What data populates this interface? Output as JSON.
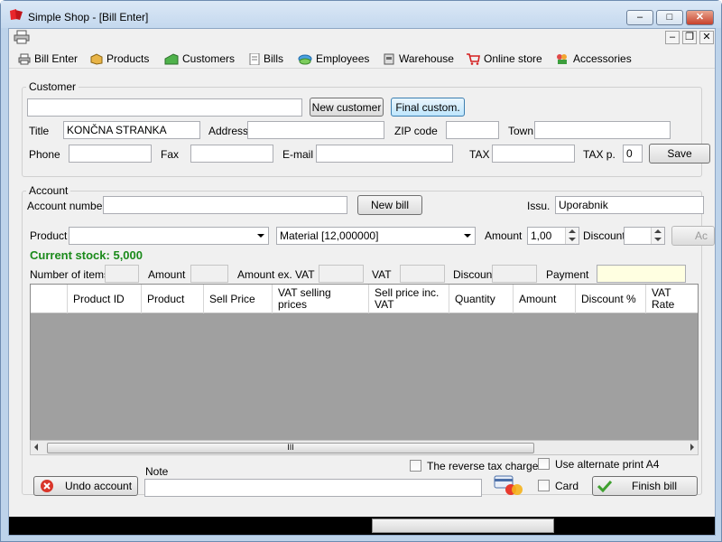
{
  "window": {
    "title": "Simple Shop - [Bill Enter]"
  },
  "titlebar_buttons": {
    "minimize": "‒",
    "maximize": "□",
    "close": "✕"
  },
  "mdi_buttons": {
    "minimize": "–",
    "restore": "❐",
    "close": "✕"
  },
  "menu": [
    {
      "label": "Bill Enter",
      "icon": "printer-icon"
    },
    {
      "label": "Products",
      "icon": "box-icon"
    },
    {
      "label": "Customers",
      "icon": "flag-icon"
    },
    {
      "label": "Bills",
      "icon": "document-icon"
    },
    {
      "label": "Employees",
      "icon": "people-icon"
    },
    {
      "label": "Warehouse",
      "icon": "warehouse-icon"
    },
    {
      "label": "Online store",
      "icon": "cart-icon"
    },
    {
      "label": "Accessories",
      "icon": "tools-icon"
    }
  ],
  "customer": {
    "group_label": "Customer",
    "search_value": "",
    "new_customer_label": "New customer",
    "final_customer_label": "Final custom.",
    "title_label": "Title",
    "title_value": "KONČNA STRANKA",
    "address_label": "Address",
    "address_value": "",
    "zip_label": "ZIP code",
    "zip_value": "",
    "town_label": "Town",
    "town_value": "",
    "phone_label": "Phone",
    "phone_value": "",
    "fax_label": "Fax",
    "fax_value": "",
    "email_label": "E-mail",
    "email_value": "",
    "tax_label": "TAX",
    "tax_value": "",
    "taxp_label": "TAX p.",
    "taxp_value": "0",
    "save_label": "Save"
  },
  "account": {
    "group_label": "Account",
    "number_label": "Account number",
    "number_value": "",
    "new_bill_label": "New bill",
    "issu_label": "Issu.",
    "issu_value": "Uporabnik",
    "product_label": "Product",
    "product_value": "",
    "material_value": "Material [12,000000]",
    "amount_label": "Amount",
    "amount_value": "1,00",
    "discount_label": "Discount",
    "discount_value": "",
    "add_label": "Ac",
    "current_stock": "Current stock: 5,000",
    "summary": {
      "items_label": "Number of items",
      "amount_label": "Amount",
      "amount_ex_vat_label": "Amount ex. VAT",
      "vat_label": "VAT",
      "discount_label": "Discount",
      "payment_label": "Payment"
    }
  },
  "table": {
    "columns": [
      "Product ID",
      "Product",
      "Sell Price",
      "VAT selling prices",
      "Sell price inc. VAT",
      "Quantity",
      "Amount",
      "Discount %",
      "VAT Rate"
    ],
    "rows": [],
    "scroll_grip": "III"
  },
  "bottom": {
    "undo_label": "Undo account",
    "note_label": "Note",
    "note_value": "",
    "reverse_tax_label": "The reverse tax charge",
    "alt_print_label": "Use alternate print A4",
    "card_label": "Card",
    "finish_label": "Finish bill"
  },
  "colors": {
    "accent_stock": "#1b8a1b",
    "payment_field": "#ffffe1",
    "grid_bg": "#a0a0a0",
    "statusbar": "#000000"
  }
}
